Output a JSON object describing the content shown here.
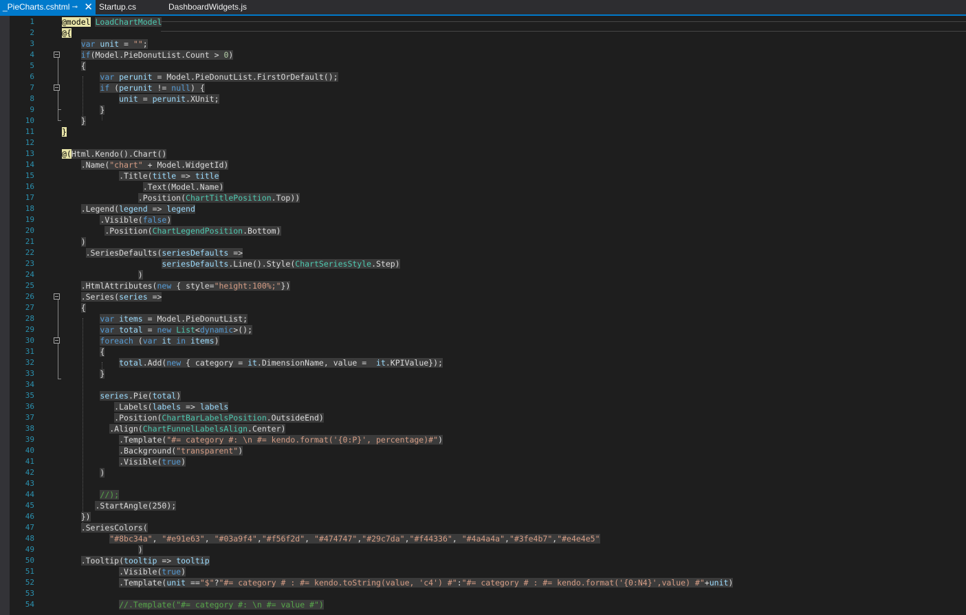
{
  "tabs": [
    {
      "name": "_PieCharts.cshtml",
      "active": true,
      "pin_icon": "pin-icon",
      "close_icon": "close-icon"
    },
    {
      "name": "Startup.cs",
      "active": false
    },
    {
      "name": "DashboardWidgets.js",
      "active": false
    }
  ],
  "colors": {
    "editor_bg": "#1e1e1e",
    "tab_active": "#007acc",
    "line_number": "#2b91af",
    "keyword": "#569cd6",
    "string": "#d69d85",
    "type": "#4ec9b0",
    "comment": "#57a64a",
    "razor_highlight": "#e8e4a8"
  },
  "code_lines": [
    {
      "n": "1",
      "spans": [
        [
          "rz",
          "@model"
        ],
        [
          "i",
          " "
        ],
        [
          "ty",
          "LoadChartModel"
        ]
      ]
    },
    {
      "n": "2",
      "spans": [
        [
          "rz",
          "@{"
        ]
      ]
    },
    {
      "n": "3",
      "spans": [
        [
          "i",
          "    "
        ],
        [
          "kw",
          "var"
        ],
        [
          "id",
          " unit"
        ],
        [
          "tx",
          " = "
        ],
        [
          "str",
          "\"\""
        ],
        [
          "tx",
          ";"
        ]
      ]
    },
    {
      "n": "4",
      "spans": [
        [
          "i",
          "    "
        ],
        [
          "kw",
          "if"
        ],
        [
          "tx",
          "(Model.PieDonutList.Count > "
        ],
        [
          "num",
          "0"
        ],
        [
          "tx",
          ")"
        ]
      ]
    },
    {
      "n": "5",
      "spans": [
        [
          "i",
          "    "
        ],
        [
          "tx",
          "{"
        ]
      ]
    },
    {
      "n": "6",
      "spans": [
        [
          "i",
          "        "
        ],
        [
          "kw",
          "var"
        ],
        [
          "id",
          " perunit"
        ],
        [
          "tx",
          " = Model.PieDonutList.FirstOrDefault();"
        ]
      ]
    },
    {
      "n": "7",
      "spans": [
        [
          "i",
          "        "
        ],
        [
          "kw",
          "if"
        ],
        [
          "tx",
          " ("
        ],
        [
          "id",
          "perunit"
        ],
        [
          "tx",
          " != "
        ],
        [
          "kw",
          "null"
        ],
        [
          "tx",
          ") {"
        ]
      ]
    },
    {
      "n": "8",
      "spans": [
        [
          "i",
          "            "
        ],
        [
          "id",
          "unit"
        ],
        [
          "tx",
          " = "
        ],
        [
          "id",
          "perunit"
        ],
        [
          "tx",
          ".XUnit;"
        ]
      ]
    },
    {
      "n": "9",
      "spans": [
        [
          "i",
          "        "
        ],
        [
          "tx",
          "}"
        ]
      ]
    },
    {
      "n": "10",
      "spans": [
        [
          "i",
          "    "
        ],
        [
          "tx",
          "}"
        ]
      ]
    },
    {
      "n": "11",
      "spans": [
        [
          "rz",
          "}"
        ]
      ]
    },
    {
      "n": "12",
      "spans": []
    },
    {
      "n": "13",
      "spans": [
        [
          "rz",
          "@("
        ],
        [
          "tx",
          "Html.Kendo().Chart()"
        ]
      ]
    },
    {
      "n": "14",
      "spans": [
        [
          "i",
          "    "
        ],
        [
          "tx",
          ".Name("
        ],
        [
          "str",
          "\"chart\""
        ],
        [
          "tx",
          " + Model.WidgetId)"
        ]
      ]
    },
    {
      "n": "15",
      "spans": [
        [
          "i",
          "            "
        ],
        [
          "tx",
          ".Title("
        ],
        [
          "id",
          "title"
        ],
        [
          "tx",
          " => "
        ],
        [
          "id",
          "title"
        ]
      ]
    },
    {
      "n": "16",
      "spans": [
        [
          "i",
          "                 "
        ],
        [
          "tx",
          ".Text(Model.Name)"
        ]
      ]
    },
    {
      "n": "17",
      "spans": [
        [
          "i",
          "                "
        ],
        [
          "tx",
          ".Position("
        ],
        [
          "ty",
          "ChartTitlePosition"
        ],
        [
          "tx",
          ".Top))"
        ]
      ]
    },
    {
      "n": "18",
      "spans": [
        [
          "i",
          "    "
        ],
        [
          "tx",
          ".Legend("
        ],
        [
          "id",
          "legend"
        ],
        [
          "tx",
          " => "
        ],
        [
          "id",
          "legend"
        ]
      ]
    },
    {
      "n": "19",
      "spans": [
        [
          "i",
          "        "
        ],
        [
          "tx",
          ".Visible("
        ],
        [
          "kw",
          "false"
        ],
        [
          "tx",
          ")"
        ]
      ]
    },
    {
      "n": "20",
      "spans": [
        [
          "i",
          "         "
        ],
        [
          "tx",
          ".Position("
        ],
        [
          "ty",
          "ChartLegendPosition"
        ],
        [
          "tx",
          ".Bottom)"
        ]
      ]
    },
    {
      "n": "21",
      "spans": [
        [
          "i",
          "    "
        ],
        [
          "tx",
          ")"
        ]
      ]
    },
    {
      "n": "22",
      "spans": [
        [
          "i",
          "     "
        ],
        [
          "tx",
          ".SeriesDefaults("
        ],
        [
          "id",
          "seriesDefaults"
        ],
        [
          "tx",
          " =>"
        ]
      ]
    },
    {
      "n": "23",
      "spans": [
        [
          "i",
          "                     "
        ],
        [
          "id",
          "seriesDefaults"
        ],
        [
          "tx",
          ".Line().Style("
        ],
        [
          "ty",
          "ChartSeriesStyle"
        ],
        [
          "tx",
          ".Step)"
        ]
      ]
    },
    {
      "n": "24",
      "spans": [
        [
          "i",
          "                "
        ],
        [
          "tx",
          ")"
        ]
      ]
    },
    {
      "n": "25",
      "spans": [
        [
          "i",
          "    "
        ],
        [
          "tx",
          ".HtmlAttributes("
        ],
        [
          "kw",
          "new"
        ],
        [
          "tx",
          " { style="
        ],
        [
          "str",
          "\"height:100%;\""
        ],
        [
          "tx",
          "})"
        ]
      ]
    },
    {
      "n": "26",
      "spans": [
        [
          "i",
          "    "
        ],
        [
          "tx",
          ".Series("
        ],
        [
          "id",
          "series"
        ],
        [
          "tx",
          " =>"
        ]
      ]
    },
    {
      "n": "27",
      "spans": [
        [
          "i",
          "    "
        ],
        [
          "tx",
          "{"
        ]
      ]
    },
    {
      "n": "28",
      "spans": [
        [
          "i",
          "        "
        ],
        [
          "kw",
          "var"
        ],
        [
          "id",
          " items"
        ],
        [
          "tx",
          " = Model.PieDonutList;"
        ]
      ]
    },
    {
      "n": "29",
      "spans": [
        [
          "i",
          "        "
        ],
        [
          "kw",
          "var"
        ],
        [
          "id",
          " total"
        ],
        [
          "tx",
          " = "
        ],
        [
          "kw",
          "new"
        ],
        [
          "tx",
          " "
        ],
        [
          "ty",
          "List"
        ],
        [
          "tx",
          "<"
        ],
        [
          "kw",
          "dynamic"
        ],
        [
          "tx",
          ">();"
        ]
      ]
    },
    {
      "n": "30",
      "spans": [
        [
          "i",
          "        "
        ],
        [
          "kw",
          "foreach"
        ],
        [
          "tx",
          " ("
        ],
        [
          "kw",
          "var"
        ],
        [
          "id",
          " it"
        ],
        [
          "kw",
          " in"
        ],
        [
          "id",
          " items"
        ],
        [
          "tx",
          ")"
        ]
      ]
    },
    {
      "n": "31",
      "spans": [
        [
          "i",
          "        "
        ],
        [
          "tx",
          "{"
        ]
      ]
    },
    {
      "n": "32",
      "spans": [
        [
          "i",
          "            "
        ],
        [
          "id",
          "total"
        ],
        [
          "tx",
          ".Add("
        ],
        [
          "kw",
          "new"
        ],
        [
          "tx",
          " { category = "
        ],
        [
          "id",
          "it"
        ],
        [
          "tx",
          ".DimensionName, value =  "
        ],
        [
          "id",
          "it"
        ],
        [
          "tx",
          ".KPIValue});"
        ]
      ]
    },
    {
      "n": "33",
      "spans": [
        [
          "i",
          "        "
        ],
        [
          "tx",
          "}"
        ]
      ]
    },
    {
      "n": "34",
      "spans": []
    },
    {
      "n": "35",
      "spans": [
        [
          "i",
          "        "
        ],
        [
          "id",
          "series"
        ],
        [
          "tx",
          ".Pie("
        ],
        [
          "id",
          "total"
        ],
        [
          "tx",
          ")"
        ]
      ]
    },
    {
      "n": "36",
      "spans": [
        [
          "i",
          "           "
        ],
        [
          "tx",
          ".Labels("
        ],
        [
          "id",
          "labels"
        ],
        [
          "tx",
          " => "
        ],
        [
          "id",
          "labels"
        ]
      ]
    },
    {
      "n": "37",
      "spans": [
        [
          "i",
          "           "
        ],
        [
          "tx",
          ".Position("
        ],
        [
          "ty",
          "ChartBarLabelsPosition"
        ],
        [
          "tx",
          ".OutsideEnd)"
        ]
      ]
    },
    {
      "n": "38",
      "spans": [
        [
          "i",
          "          "
        ],
        [
          "tx",
          ".Align("
        ],
        [
          "ty",
          "ChartFunnelLabelsAlign"
        ],
        [
          "tx",
          ".Center)"
        ]
      ]
    },
    {
      "n": "39",
      "spans": [
        [
          "i",
          "            "
        ],
        [
          "tx",
          ".Template("
        ],
        [
          "str",
          "\"#= category #: \\n #= kendo.format('{0:P}', percentage)#\""
        ],
        [
          "tx",
          ")"
        ]
      ]
    },
    {
      "n": "40",
      "spans": [
        [
          "i",
          "            "
        ],
        [
          "tx",
          ".Background("
        ],
        [
          "str",
          "\"transparent\""
        ],
        [
          "tx",
          ")"
        ]
      ]
    },
    {
      "n": "41",
      "spans": [
        [
          "i",
          "            "
        ],
        [
          "tx",
          ".Visible("
        ],
        [
          "kw",
          "true"
        ],
        [
          "tx",
          ")"
        ]
      ]
    },
    {
      "n": "42",
      "spans": [
        [
          "i",
          "        "
        ],
        [
          "tx",
          ")"
        ]
      ]
    },
    {
      "n": "43",
      "spans": []
    },
    {
      "n": "44",
      "spans": [
        [
          "i",
          "        "
        ],
        [
          "cm",
          "//);"
        ]
      ]
    },
    {
      "n": "45",
      "spans": [
        [
          "i",
          "       "
        ],
        [
          "tx",
          ".StartAngle(250);"
        ]
      ]
    },
    {
      "n": "46",
      "spans": [
        [
          "i",
          "    "
        ],
        [
          "tx",
          "})"
        ]
      ]
    },
    {
      "n": "47",
      "spans": [
        [
          "i",
          "    "
        ],
        [
          "tx",
          ".SeriesColors("
        ]
      ]
    },
    {
      "n": "48",
      "spans": [
        [
          "i",
          "          "
        ],
        [
          "str",
          "\"#8bc34a\""
        ],
        [
          "tx",
          ", "
        ],
        [
          "str",
          "\"#e91e63\""
        ],
        [
          "tx",
          ", "
        ],
        [
          "str",
          "\"#03a9f4\""
        ],
        [
          "tx",
          ","
        ],
        [
          "str",
          "\"#f56f2d\""
        ],
        [
          "tx",
          ", "
        ],
        [
          "str",
          "\"#474747\""
        ],
        [
          "tx",
          ","
        ],
        [
          "str",
          "\"#29c7da\""
        ],
        [
          "tx",
          ","
        ],
        [
          "str",
          "\"#f44336\""
        ],
        [
          "tx",
          ", "
        ],
        [
          "str",
          "\"#4a4a4a\""
        ],
        [
          "tx",
          ","
        ],
        [
          "str",
          "\"#3fe4b7\""
        ],
        [
          "tx",
          ","
        ],
        [
          "str",
          "\"#e4e4e5\""
        ]
      ]
    },
    {
      "n": "49",
      "spans": [
        [
          "i",
          "                "
        ],
        [
          "tx",
          ")"
        ]
      ]
    },
    {
      "n": "50",
      "spans": [
        [
          "i",
          "    "
        ],
        [
          "tx",
          ".Tooltip("
        ],
        [
          "id",
          "tooltip"
        ],
        [
          "tx",
          " => "
        ],
        [
          "id",
          "tooltip"
        ]
      ]
    },
    {
      "n": "51",
      "spans": [
        [
          "i",
          "            "
        ],
        [
          "tx",
          ".Visible("
        ],
        [
          "kw",
          "true"
        ],
        [
          "tx",
          ")"
        ]
      ]
    },
    {
      "n": "52",
      "spans": [
        [
          "i",
          "            "
        ],
        [
          "tx",
          ".Template("
        ],
        [
          "id",
          "unit"
        ],
        [
          "tx",
          " =="
        ],
        [
          "str",
          "\"$\""
        ],
        [
          "tx",
          "?"
        ],
        [
          "str",
          "\"#= category # : #= kendo.toString(value, 'c4') #\""
        ],
        [
          "tx",
          ":"
        ],
        [
          "str",
          "\"#= category # : #= kendo.format('{0:N4}',value) #\""
        ],
        [
          "tx",
          "+"
        ],
        [
          "id",
          "unit"
        ],
        [
          "tx",
          ")"
        ]
      ]
    },
    {
      "n": "53",
      "spans": []
    },
    {
      "n": "54",
      "spans": [
        [
          "i",
          "            "
        ],
        [
          "cm",
          "//.Template(\"#= category #: \\n #= value #\")"
        ]
      ]
    }
  ]
}
